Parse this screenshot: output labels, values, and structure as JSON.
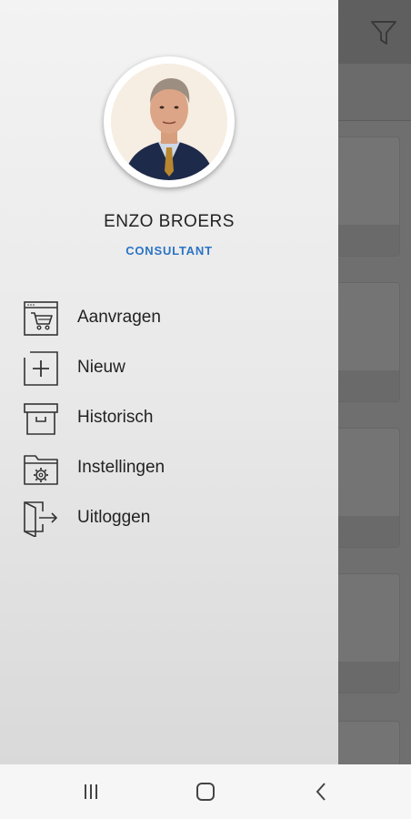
{
  "profile": {
    "name": "ENZO BROERS",
    "role": "CONSULTANT"
  },
  "menu": {
    "items": [
      {
        "label": "Aanvragen",
        "icon": "cart-icon"
      },
      {
        "label": "Nieuw",
        "icon": "plus-square-icon"
      },
      {
        "label": "Historisch",
        "icon": "archive-box-icon"
      },
      {
        "label": "Instellingen",
        "icon": "folder-gear-icon"
      },
      {
        "label": "Uitloggen",
        "icon": "logout-icon"
      }
    ]
  },
  "background_app": {
    "icons": [
      "clock-icon",
      "filter-icon"
    ]
  },
  "navbar": {
    "buttons": [
      "recent-apps-icon",
      "home-icon",
      "back-icon"
    ]
  },
  "colors": {
    "role_accent": "#2b74c4",
    "drawer_bg": "#ececec",
    "scrim": "#6f6f6f"
  }
}
